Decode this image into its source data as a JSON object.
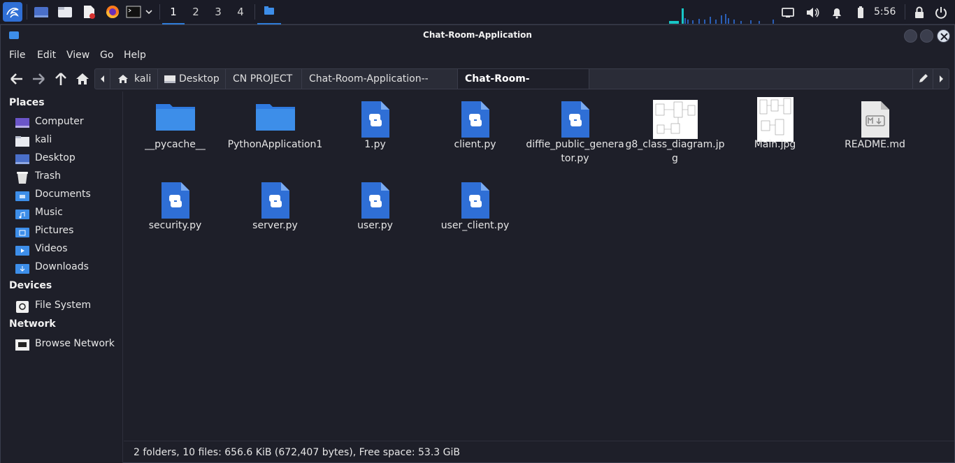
{
  "panel": {
    "workspaces": [
      "1",
      "2",
      "3",
      "4"
    ],
    "clock": "5:56"
  },
  "window": {
    "title": "Chat-Room-Application"
  },
  "menu": {
    "file": "File",
    "edit": "Edit",
    "view": "View",
    "go": "Go",
    "help": "Help"
  },
  "path": {
    "home": "kali",
    "desktop": "Desktop",
    "project": "CN PROJECT",
    "repo": "Chat-Room-Application--main",
    "current": "Chat-Room-Application"
  },
  "sidebar": {
    "places_header": "Places",
    "places": [
      {
        "label": "Computer",
        "icon": "computer-icon"
      },
      {
        "label": "kali",
        "icon": "home-folder-icon"
      },
      {
        "label": "Desktop",
        "icon": "desktop-icon"
      },
      {
        "label": "Trash",
        "icon": "trash-icon"
      },
      {
        "label": "Documents",
        "icon": "documents-folder-icon"
      },
      {
        "label": "Music",
        "icon": "music-folder-icon"
      },
      {
        "label": "Pictures",
        "icon": "pictures-folder-icon"
      },
      {
        "label": "Videos",
        "icon": "videos-folder-icon"
      },
      {
        "label": "Downloads",
        "icon": "downloads-folder-icon"
      }
    ],
    "devices_header": "Devices",
    "devices": [
      {
        "label": "File System",
        "icon": "drive-icon"
      }
    ],
    "network_header": "Network",
    "network": [
      {
        "label": "Browse Network",
        "icon": "network-icon"
      }
    ]
  },
  "files": [
    {
      "name": "__pycache__",
      "type": "folder"
    },
    {
      "name": "PythonApplication1",
      "type": "folder"
    },
    {
      "name": "1.py",
      "type": "python"
    },
    {
      "name": "client.py",
      "type": "python"
    },
    {
      "name": "diffie_public_generator.py",
      "type": "python"
    },
    {
      "name": "g8_class_diagram.jpg",
      "type": "image"
    },
    {
      "name": "Main.jpg",
      "type": "image"
    },
    {
      "name": "README.md",
      "type": "markdown"
    },
    {
      "name": "security.py",
      "type": "python"
    },
    {
      "name": "server.py",
      "type": "python"
    },
    {
      "name": "user.py",
      "type": "python"
    },
    {
      "name": "user_client.py",
      "type": "python"
    }
  ],
  "status": {
    "text": "2 folders, 10 files: 656.6 KiB (672,407 bytes), Free space: 53.3 GiB"
  },
  "colors": {
    "accent": "#2e7bd6",
    "folder": "#3d8ee9",
    "python_file": "#2f6fd6",
    "background": "#1e1f29"
  }
}
